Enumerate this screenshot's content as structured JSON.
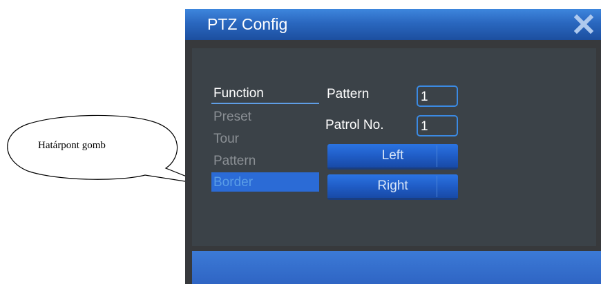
{
  "callout": {
    "text": "Határpont gomb"
  },
  "window": {
    "title": "PTZ Config",
    "close_icon": "close-icon"
  },
  "menu": {
    "items": [
      {
        "label": "Function",
        "state": "active"
      },
      {
        "label": "Preset",
        "state": "normal"
      },
      {
        "label": "Tour",
        "state": "normal"
      },
      {
        "label": "Pattern",
        "state": "normal"
      },
      {
        "label": "Border",
        "state": "selected"
      }
    ]
  },
  "form": {
    "pattern_label": "Pattern",
    "pattern_value": "1",
    "patrol_label": "Patrol No.",
    "patrol_value": "1"
  },
  "buttons": {
    "left": "Left",
    "right": "Right"
  },
  "colors": {
    "titlebar": "#2a67bf",
    "panel": "#3b4248",
    "accent": "#3b8ae3",
    "selected": "#2b6bd6"
  }
}
